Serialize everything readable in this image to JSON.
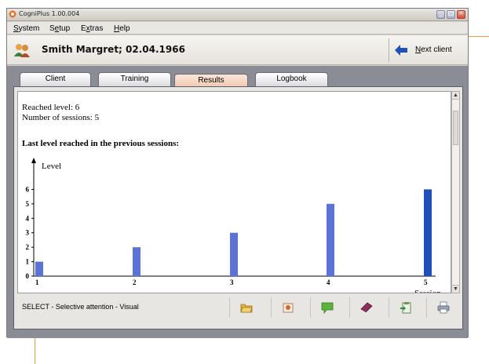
{
  "window": {
    "title": "CogniPlus 1.00.004"
  },
  "menu": {
    "items": [
      {
        "label": "System",
        "mnemonic": "S"
      },
      {
        "label": "Setup",
        "mnemonic": "e"
      },
      {
        "label": "Extras",
        "mnemonic": "x"
      },
      {
        "label": "Help",
        "mnemonic": "H"
      }
    ]
  },
  "client": {
    "name": "Smith Margret; 02.04.1966",
    "next_label": "Next client"
  },
  "tabs": [
    {
      "label": "Client",
      "active": false
    },
    {
      "label": "Training",
      "active": false
    },
    {
      "label": "Results",
      "active": true
    },
    {
      "label": "Logbook",
      "active": false
    }
  ],
  "results": {
    "reached_level": "Reached level: 6",
    "sessions": "Number of sessions: 5",
    "heading": "Last level reached in the previous sessions:"
  },
  "chart_data": {
    "type": "bar",
    "title": "Last level reached in the previous sessions:",
    "xlabel": "Session",
    "ylabel": "Level",
    "categories": [
      "1",
      "2",
      "3",
      "4",
      "5"
    ],
    "values": [
      1,
      2,
      3,
      5,
      6
    ],
    "ylim": [
      0,
      7
    ],
    "yticks": [
      0,
      1,
      2,
      3,
      4,
      5,
      6
    ],
    "grid": false,
    "bar_color": "#5b72d6",
    "last_bar_color": "#1f4fb8"
  },
  "status": {
    "text": "SELECT - Selective attention - Visual"
  },
  "toolbar": {
    "tools": [
      {
        "icon": "open-folder-icon"
      },
      {
        "icon": "stamp-icon"
      },
      {
        "icon": "comment-icon"
      },
      {
        "icon": "book-icon"
      },
      {
        "icon": "clipboard-icon"
      },
      {
        "icon": "printer-icon"
      }
    ]
  },
  "colors": {
    "accent_orange": "#f39a3c",
    "active_tab": "#f1c9b2",
    "tab_area": "#8a8d95"
  }
}
